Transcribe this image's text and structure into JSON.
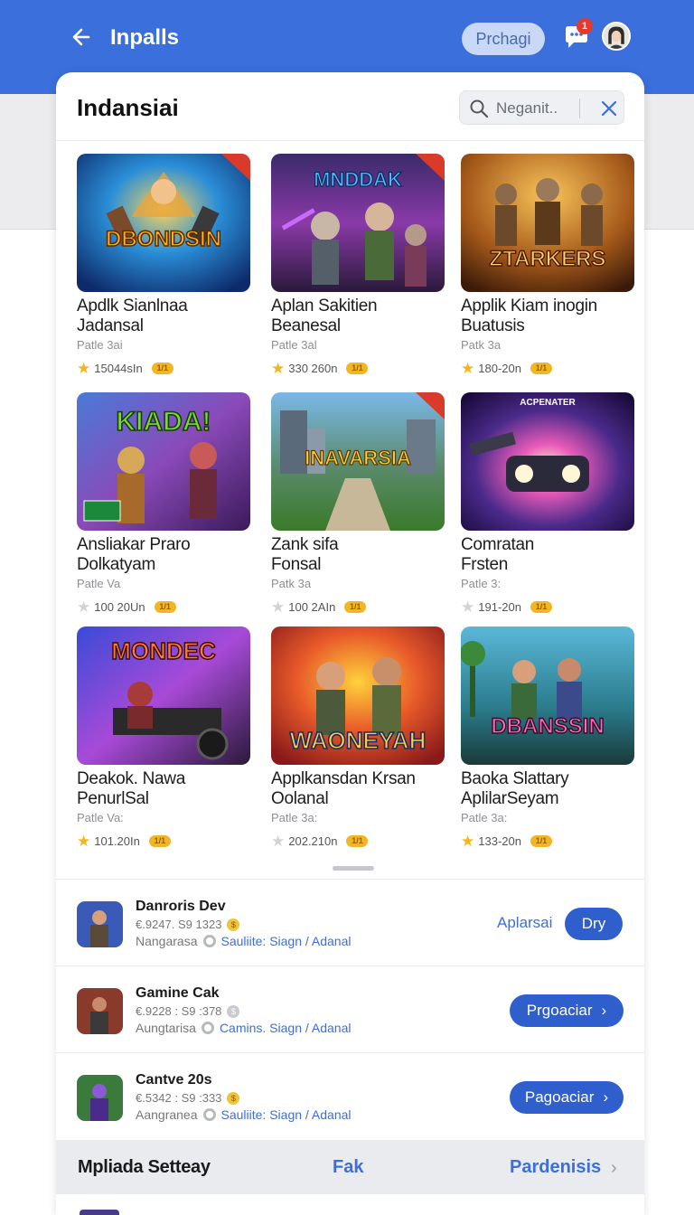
{
  "header": {
    "title": "Inpalls",
    "pill_label": "Prchagi",
    "notification_count": "1"
  },
  "panel": {
    "title": "Indansiai",
    "search_placeholder": "Neganit.."
  },
  "games": [
    {
      "art_title": "DBONDSIN",
      "name_line1": "Apdlk Sianlnaa",
      "name_line2": "Jadansal",
      "sub": "Patle 3ai",
      "stats": "15044sIn",
      "star": "gold",
      "coin": "1/1"
    },
    {
      "art_title": "MNDDAK",
      "name_line1": "Aplan Sakitien",
      "name_line2": "Beanesal",
      "sub": "Patle 3al",
      "stats": "330 260n",
      "star": "gold",
      "coin": "1/1"
    },
    {
      "art_title": "ZTARKERS",
      "name_line1": "Applik Kiam inogin",
      "name_line2": "Buatusis",
      "sub": "Patk 3a",
      "stats": "180-20n",
      "star": "gold",
      "coin": "1/1"
    },
    {
      "art_title": "KIADA!",
      "name_line1": "Ansliakar Praro",
      "name_line2": "Dolkatyam",
      "sub": "Patle Va",
      "stats": "100 20Un",
      "star": "grey",
      "coin": "1/1"
    },
    {
      "art_title": "INAVARSIA",
      "name_line1": "Zank sifa",
      "name_line2": "Fonsal",
      "sub": "Patk 3a",
      "stats": "100 2AIn",
      "star": "grey",
      "coin": "1/1"
    },
    {
      "art_title": "ACPENATER",
      "name_line1": "Comratan",
      "name_line2": "Frsten",
      "sub": "Patle 3:",
      "stats": "191-20n",
      "star": "grey",
      "coin": "1/1"
    },
    {
      "art_title": "MONDEC",
      "name_line1": "Deakok. Nawa",
      "name_line2": "PenurlSal",
      "sub": "Patle Va:",
      "stats": "101.20In",
      "star": "gold",
      "coin": "1/1"
    },
    {
      "art_title": "WAONEYAH",
      "name_line1": "Applkansdan Krsan",
      "name_line2": "Oolanal",
      "sub": "Patle 3a:",
      "stats": "202.210n",
      "star": "grey",
      "coin": "1/1"
    },
    {
      "art_title": "DBANSSIN",
      "name_line1": "Baoka Slattary",
      "name_line2": "AplilarSeyam",
      "sub": "Patle 3a:",
      "stats": "133-20n",
      "star": "gold",
      "coin": "1/1"
    }
  ],
  "list": [
    {
      "title": "Danroris Dev",
      "meta": "€.9247. S9 1323",
      "label": "Nangarasa",
      "link": "Sauliite: Siagn / Adanal",
      "alt": "Aplarsai",
      "button": "Dry"
    },
    {
      "title": "Gamine Cak",
      "meta": "€.9228 : S9 :378",
      "label": "Aungtarisa",
      "link": "Camins. Siagn / Adanal",
      "button": "Prgoaciar"
    },
    {
      "title": "Cantve 20s",
      "meta": "€.5342 : S9 :333",
      "label": "Aangranea",
      "link": "Sauliite: Siagn / Adanal",
      "button": "Pagoaciar"
    }
  ],
  "footer": {
    "left": "Mpliada Setteay",
    "middle": "Fak",
    "right": "Pardenisis"
  },
  "colors": {
    "brand_blue": "#3a6fdc",
    "button_blue": "#2f5fcc",
    "star_gold": "#f3b51b"
  }
}
